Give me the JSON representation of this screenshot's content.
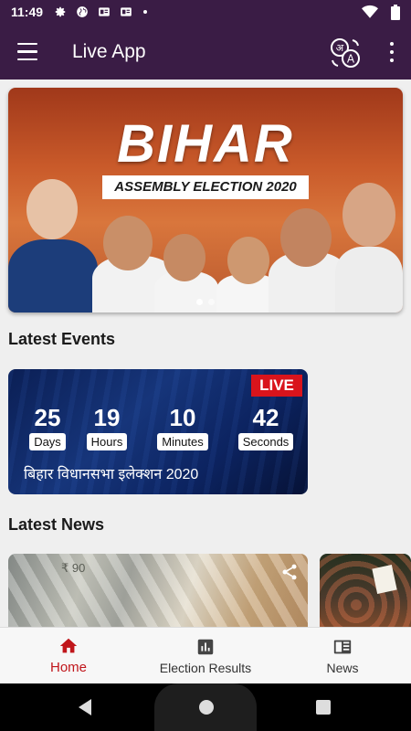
{
  "status_bar": {
    "time": "11:49",
    "icons": [
      "gear-icon",
      "globe-icon",
      "sim-card-icon",
      "sim-card-icon",
      "dot-icon"
    ],
    "right_icons": [
      "wifi-icon",
      "battery-icon"
    ]
  },
  "app_bar": {
    "menu_icon": "hamburger-icon",
    "title": "Live App",
    "translate_icon": "translate-icon",
    "more_icon": "more-vert-icon",
    "background": "#3a1c45"
  },
  "banner": {
    "title": "BIHAR",
    "subtitle": "ASSEMBLY ELECTION 2020",
    "page_count": 2,
    "active_page": 1
  },
  "latest_events": {
    "heading": "Latest Events",
    "event": {
      "badge": "LIVE",
      "countdown": [
        {
          "value": "25",
          "label": "Days"
        },
        {
          "value": "19",
          "label": "Hours"
        },
        {
          "value": "10",
          "label": "Minutes"
        },
        {
          "value": "42",
          "label": "Seconds"
        }
      ],
      "name": "बिहार विधानसभा इलेक्शन 2020"
    }
  },
  "latest_news": {
    "heading": "Latest News",
    "items": [
      {
        "image_text": "₹ 90",
        "share_icon": "share-icon"
      },
      {
        "image_text": ""
      }
    ]
  },
  "bottom_nav": {
    "accent": "#c0161b",
    "items": [
      {
        "label": "Home",
        "icon": "home-icon",
        "active": true
      },
      {
        "label": "Election Results",
        "icon": "bar-chart-icon",
        "active": false
      },
      {
        "label": "News",
        "icon": "newspaper-icon",
        "active": false
      }
    ]
  }
}
